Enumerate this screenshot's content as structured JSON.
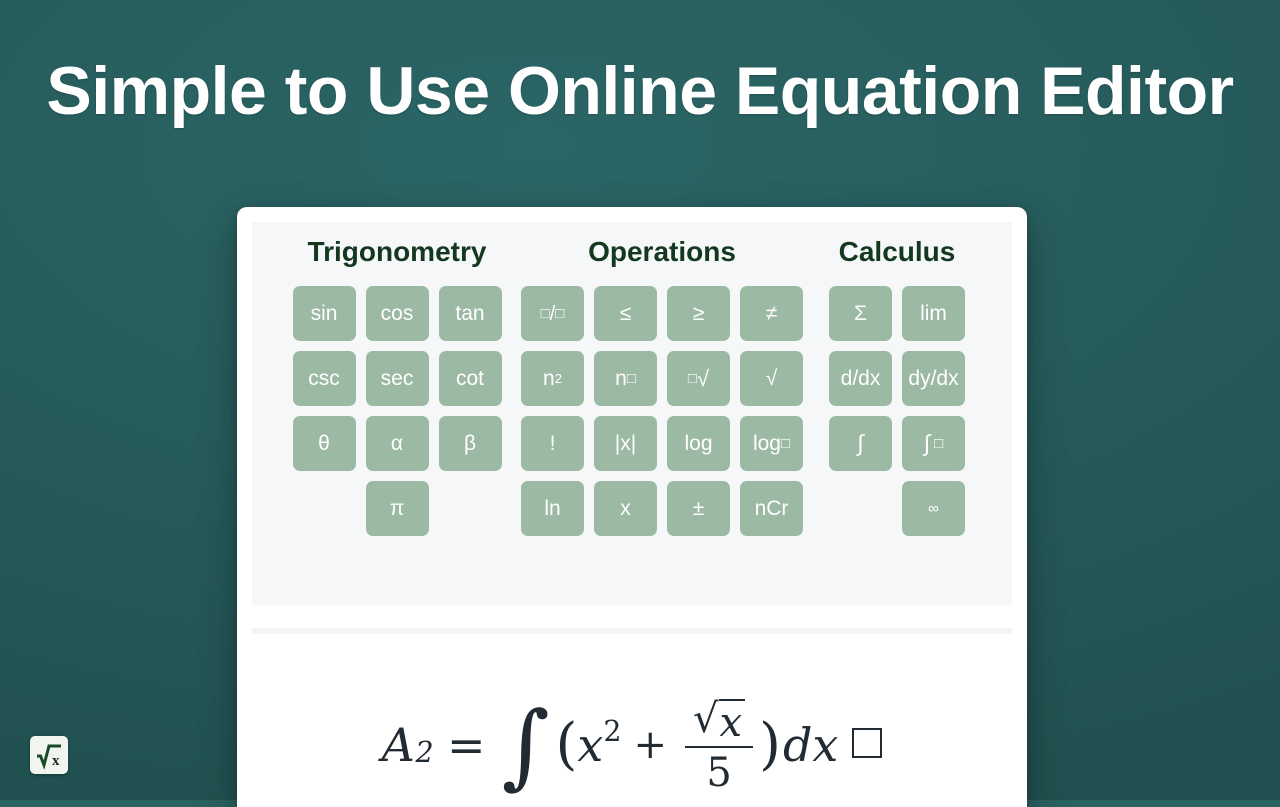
{
  "page": {
    "title": "Simple to Use Online Equation Editor",
    "background_color": "#275c5c"
  },
  "colors": {
    "background_teal": "#275c5c",
    "card_white": "#ffffff",
    "panel_gray": "#f5f7f8",
    "key_green": "#9cb9a3",
    "heading_green": "#14381f",
    "key_text": "#ffffff",
    "math_ink": "#222b33"
  },
  "keypad": {
    "groups": [
      {
        "title": "Trigonometry",
        "columns": 3,
        "keys": [
          {
            "label": "sin",
            "name": "key-sin"
          },
          {
            "label": "cos",
            "name": "key-cos"
          },
          {
            "label": "tan",
            "name": "key-tan"
          },
          {
            "label": "csc",
            "name": "key-csc"
          },
          {
            "label": "sec",
            "name": "key-sec"
          },
          {
            "label": "cot",
            "name": "key-cot"
          },
          {
            "label": "θ",
            "name": "key-theta"
          },
          {
            "label": "α",
            "name": "key-alpha"
          },
          {
            "label": "β",
            "name": "key-beta"
          },
          {
            "label": "π",
            "name": "key-pi",
            "position": "center-column"
          }
        ]
      },
      {
        "title": "Operations",
        "columns": 4,
        "keys": [
          {
            "label": "□/□",
            "name": "key-fraction"
          },
          {
            "label": "≤",
            "name": "key-less-than-or-equal"
          },
          {
            "label": "≥",
            "name": "key-greater-than-or-equal"
          },
          {
            "label": "≠",
            "name": "key-not-equal"
          },
          {
            "label": "n²",
            "name": "key-n-squared"
          },
          {
            "label": "n□",
            "name": "key-n-power"
          },
          {
            "label": "□√",
            "name": "key-nth-root"
          },
          {
            "label": "√",
            "name": "key-square-root"
          },
          {
            "label": "!",
            "name": "key-factorial"
          },
          {
            "label": "|x|",
            "name": "key-absolute-value"
          },
          {
            "label": "log",
            "name": "key-log"
          },
          {
            "label": "log□",
            "name": "key-log-base"
          },
          {
            "label": "ln",
            "name": "key-ln"
          },
          {
            "label": "x",
            "name": "key-variable-x"
          },
          {
            "label": "±",
            "name": "key-plus-minus"
          },
          {
            "label": "nCr",
            "name": "key-ncr"
          }
        ]
      },
      {
        "title": "Calculus",
        "columns": 2,
        "keys": [
          {
            "label": "Σ",
            "name": "key-sigma-sum"
          },
          {
            "label": "lim",
            "name": "key-limit"
          },
          {
            "label": "d/dx",
            "name": "key-derivative"
          },
          {
            "label": "dy/dx",
            "name": "key-dy-dx"
          },
          {
            "label": "∫",
            "name": "key-integral"
          },
          {
            "label": "∫□",
            "name": "key-definite-integral"
          },
          {
            "label": "∞",
            "name": "key-infinity",
            "position": "center-column"
          }
        ]
      }
    ]
  },
  "equation": {
    "latex": "A_2 = \\int (x^2 + \\frac{\\sqrt{x}}{5})dx\\square",
    "plain": "A2 = ∫(x² + √x/5)dx□",
    "lhs_variable": "A",
    "lhs_subscript": "2",
    "equals": "=",
    "integral": "∫",
    "open_paren": "(",
    "base": "x",
    "exponent": "2",
    "plus": "+",
    "numerator_root": "√",
    "numerator_radicand": "x",
    "denominator": "5",
    "close_paren": ")",
    "differential": "dx",
    "cursor_placeholder": "□"
  },
  "taskbar": {
    "app_icon_name": "equation-editor-icon",
    "app_icon_glyph": "√",
    "app_icon_letter": "x"
  }
}
